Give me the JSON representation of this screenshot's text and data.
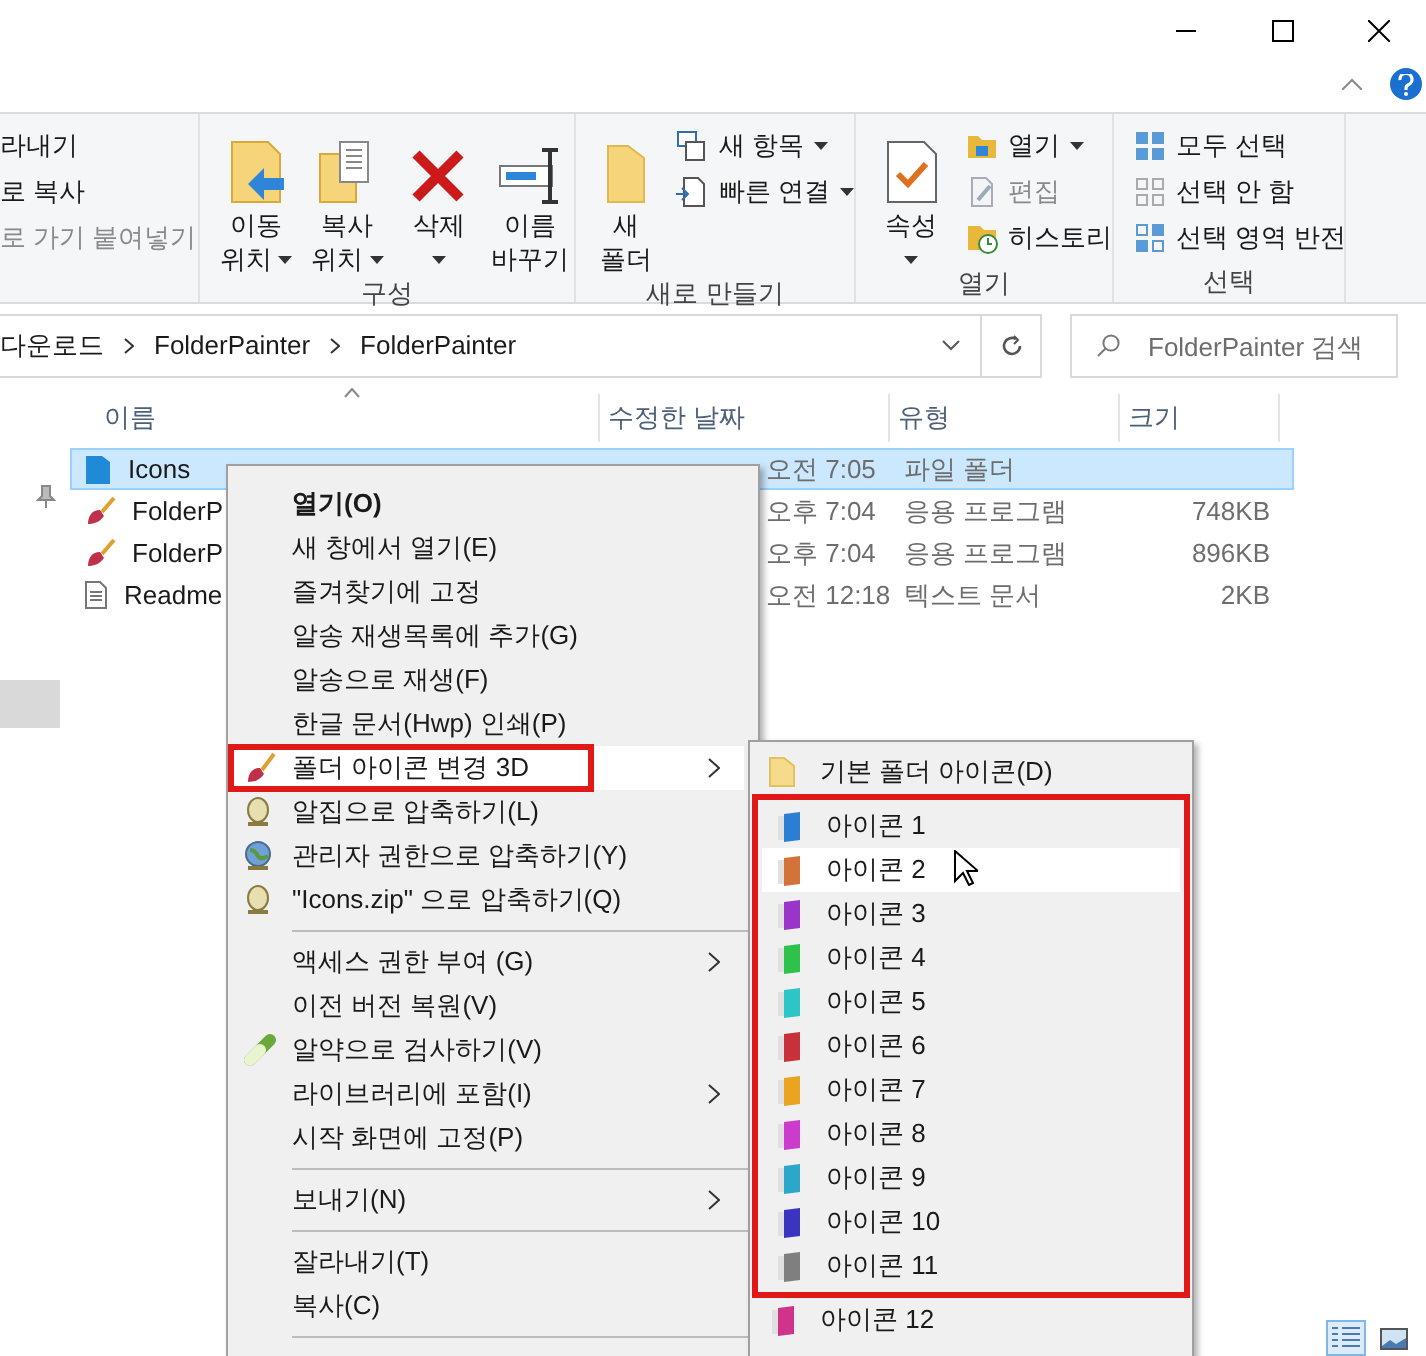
{
  "ribbon": {
    "groups": [
      {
        "buttons": [
          {
            "kind": "small",
            "label": "라내기",
            "disabled": false
          },
          {
            "kind": "small",
            "label": "로 복사",
            "disabled": false
          },
          {
            "kind": "small",
            "label": "로 가기 붙여넣기",
            "disabled": true
          }
        ]
      },
      {
        "label": "구성",
        "buttons": [
          {
            "kind": "large",
            "label": "이동\n위치",
            "dropdown": true
          },
          {
            "kind": "large",
            "label": "복사\n위치",
            "dropdown": true
          },
          {
            "kind": "large",
            "label": "삭제",
            "dropdown": true
          },
          {
            "kind": "large",
            "label": "이름\n바꾸기",
            "dropdown": false
          }
        ]
      },
      {
        "label": "새로 만들기",
        "buttons": [
          {
            "kind": "large",
            "label": "새\n폴더",
            "dropdown": false
          },
          {
            "kind": "small",
            "label": "새 항목",
            "dropdown": true,
            "disabled": false
          },
          {
            "kind": "small",
            "label": "빠른 연결",
            "dropdown": true,
            "disabled": false
          }
        ]
      },
      {
        "label": "열기",
        "buttons": [
          {
            "kind": "large",
            "label": "속성",
            "dropdown": true
          },
          {
            "kind": "small",
            "label": "열기",
            "dropdown": true,
            "disabled": false
          },
          {
            "kind": "small",
            "label": "편집",
            "dropdown": false,
            "disabled": true
          },
          {
            "kind": "small",
            "label": "히스토리",
            "dropdown": false,
            "disabled": false
          }
        ]
      },
      {
        "label": "선택",
        "buttons": [
          {
            "kind": "small",
            "label": "모두 선택",
            "disabled": false
          },
          {
            "kind": "small",
            "label": "선택 안 함",
            "disabled": false
          },
          {
            "kind": "small",
            "label": "선택 영역 반전",
            "disabled": false
          }
        ]
      }
    ]
  },
  "address": {
    "crumbs": [
      "다운로드",
      "FolderPainter",
      "FolderPainter"
    ]
  },
  "search": {
    "placeholder": "FolderPainter 검색"
  },
  "columns": [
    "이름",
    "수정한 날짜",
    "유형",
    "크기"
  ],
  "files": [
    {
      "kind": "folder",
      "name": "Icons",
      "date": "오전 7:05",
      "type": "파일 폴더",
      "selected": true
    },
    {
      "kind": "app",
      "name": "FolderP",
      "date": "오후 7:04",
      "type": "응용 프로그램",
      "size": "748KB",
      "selected": false
    },
    {
      "kind": "app",
      "name": "FolderP",
      "date": "오후 7:04",
      "type": "응용 프로그램",
      "size": "896KB",
      "selected": false
    },
    {
      "kind": "text",
      "name": "Readme",
      "date": "오전 12:18",
      "type": "텍스트 문서",
      "size": "2KB",
      "selected": false
    }
  ],
  "context_menu": [
    {
      "kind": "item",
      "label": "열기(O)",
      "bold": true,
      "selected": false
    },
    {
      "kind": "item",
      "label": "새 창에서 열기(E)",
      "selected": false
    },
    {
      "kind": "item",
      "label": "즐겨찾기에 고정",
      "selected": false
    },
    {
      "kind": "item",
      "label": "알송 재생목록에 추가(G)",
      "selected": false
    },
    {
      "kind": "item",
      "label": "알송으로 재생(F)",
      "selected": false
    },
    {
      "kind": "item",
      "label": "한글 문서(Hwp) 인쇄(P)",
      "selected": false
    },
    {
      "kind": "item",
      "label": "폴더 아이콘 변경 3D",
      "submenu": true,
      "outlined": true,
      "selected": true
    },
    {
      "kind": "item",
      "label": "알집으로 압축하기(L)",
      "selected": false
    },
    {
      "kind": "item",
      "label": "관리자 권한으로 압축하기(Y)",
      "selected": false
    },
    {
      "kind": "item",
      "label": "\"Icons.zip\" 으로 압축하기(Q)",
      "selected": false
    },
    {
      "kind": "separator"
    },
    {
      "kind": "item",
      "label": "액세스 권한 부여 (G)",
      "submenu": true,
      "selected": false
    },
    {
      "kind": "item",
      "label": "이전 버전 복원(V)",
      "selected": false
    },
    {
      "kind": "item",
      "label": "알약으로 검사하기(V)",
      "selected": false
    },
    {
      "kind": "item",
      "label": "라이브러리에 포함(I)",
      "submenu": true,
      "selected": false
    },
    {
      "kind": "item",
      "label": "시작 화면에 고정(P)",
      "selected": false
    },
    {
      "kind": "separator"
    },
    {
      "kind": "item",
      "label": "보내기(N)",
      "submenu": true,
      "selected": false
    },
    {
      "kind": "separator"
    },
    {
      "kind": "item",
      "label": "잘라내기(T)",
      "selected": false
    },
    {
      "kind": "item",
      "label": "복사(C)",
      "selected": false
    },
    {
      "kind": "separator"
    }
  ],
  "submenu": [
    {
      "kind": "default",
      "label": "기본 폴더 아이콘(D)",
      "selected": false,
      "outlined": false
    },
    {
      "kind": "color",
      "label": "아이콘 1",
      "color": "#2a7fd4",
      "selected": false,
      "outlined": true
    },
    {
      "kind": "color",
      "label": "아이콘 2",
      "color": "#d2743a",
      "selected": true,
      "outlined": true
    },
    {
      "kind": "color",
      "label": "아이콘 3",
      "color": "#9b35c9",
      "selected": false,
      "outlined": true
    },
    {
      "kind": "color",
      "label": "아이콘 4",
      "color": "#2fc24a",
      "selected": false,
      "outlined": true
    },
    {
      "kind": "color",
      "label": "아이콘 5",
      "color": "#2cc6c6",
      "selected": false,
      "outlined": true
    },
    {
      "kind": "color",
      "label": "아이콘 6",
      "color": "#c8303a",
      "selected": false,
      "outlined": true
    },
    {
      "kind": "color",
      "label": "아이콘 7",
      "color": "#eaa420",
      "selected": false,
      "outlined": true
    },
    {
      "kind": "color",
      "label": "아이콘 8",
      "color": "#cc3ccc",
      "selected": false,
      "outlined": true
    },
    {
      "kind": "color",
      "label": "아이콘 9",
      "color": "#2aa7c9",
      "selected": false,
      "outlined": true
    },
    {
      "kind": "color",
      "label": "아이콘 10",
      "color": "#3a34c0",
      "selected": false,
      "outlined": true
    },
    {
      "kind": "color",
      "label": "아이콘 11",
      "color": "#7f7f7f",
      "selected": false,
      "outlined": true
    },
    {
      "kind": "color",
      "label": "아이콘 12",
      "color": "#d0338a",
      "selected": false,
      "outlined": false
    }
  ]
}
